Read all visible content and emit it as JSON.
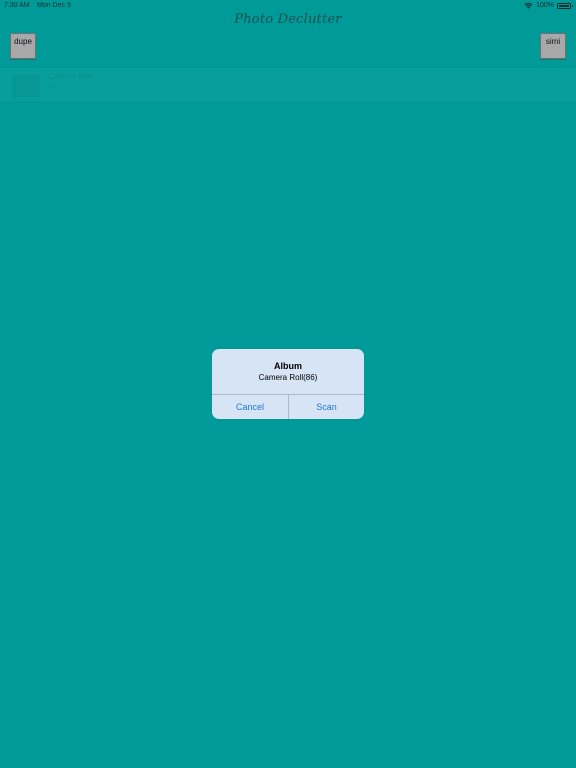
{
  "status_bar": {
    "time": "7:30 AM",
    "date": "Mon Dec 9",
    "battery": "100%"
  },
  "app": {
    "title": "Photo Declutter"
  },
  "buttons": {
    "dupe": "dupe",
    "simi": "simi"
  },
  "album_list": [
    {
      "name": "Camera Roll",
      "count": "86"
    }
  ],
  "alert": {
    "title": "Album",
    "message": "Camera Roll(86)",
    "cancel_label": "Cancel",
    "scan_label": "Scan"
  },
  "colors": {
    "background": "#009b98",
    "alert_background": "#d6e4f6",
    "alert_button_text": "#1b77d6",
    "corner_button": "#a8a8a8"
  }
}
